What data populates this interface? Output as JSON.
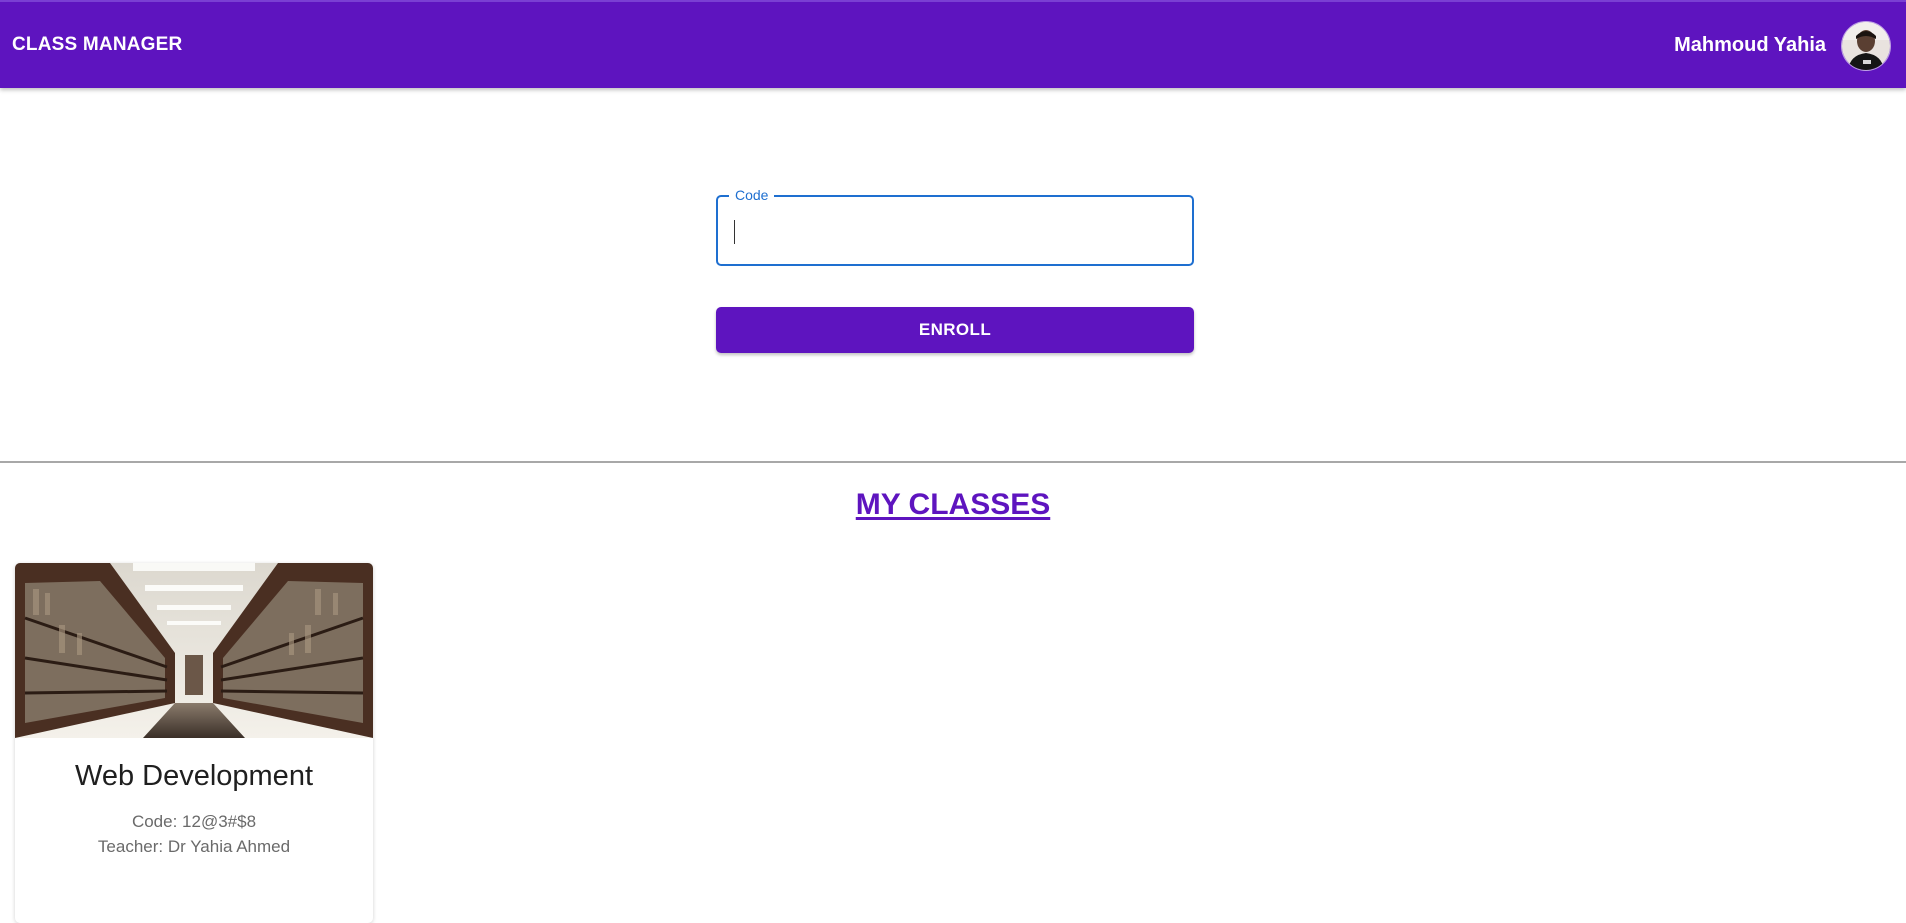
{
  "appbar": {
    "brand": "CLASS MANAGER",
    "user_name": "Mahmoud Yahia",
    "avatar_icon": "user-avatar"
  },
  "enroll": {
    "code_label": "Code",
    "code_value": "",
    "button_label": "ENROLL"
  },
  "classes_section": {
    "title": "MY CLASSES",
    "classes": [
      {
        "title": "Web Development",
        "code_line": "Code: 12@3#$8",
        "teacher_line": "Teacher: Dr Yahia Ahmed",
        "image_icon": "library-bookshelves-image"
      }
    ]
  },
  "colors": {
    "primary": "#5e14bf",
    "focus_outline": "#1e6fd0",
    "divider": "#a8a8a8"
  }
}
